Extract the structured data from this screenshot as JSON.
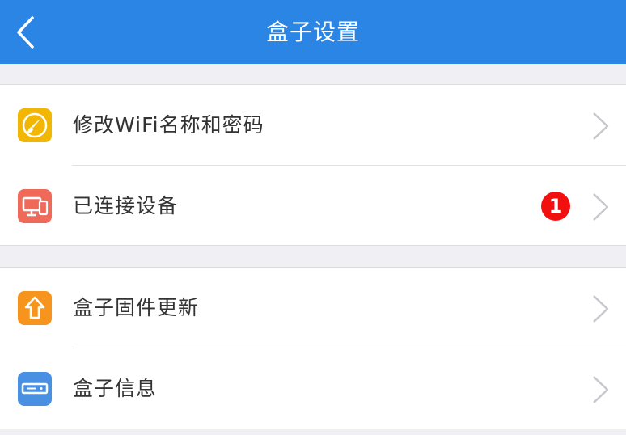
{
  "header": {
    "title": "盒子设置",
    "back_icon": "chevron-left-icon",
    "background_color": "#2b85e4"
  },
  "groups": [
    {
      "items": [
        {
          "label": "修改WiFi名称和密码",
          "icon": "paintbrush-icon",
          "icon_color": "#f2b705"
        },
        {
          "label": "已连接设备",
          "icon": "devices-icon",
          "icon_color": "#f06a5a",
          "badge": "1"
        }
      ]
    },
    {
      "items": [
        {
          "label": "盒子固件更新",
          "icon": "upload-arrow-icon",
          "icon_color": "#f7941d"
        },
        {
          "label": "盒子信息",
          "icon": "router-box-icon",
          "icon_color": "#4a90e2"
        }
      ]
    }
  ],
  "colors": {
    "badge": "#f01010",
    "page_background": "#efeff4"
  }
}
